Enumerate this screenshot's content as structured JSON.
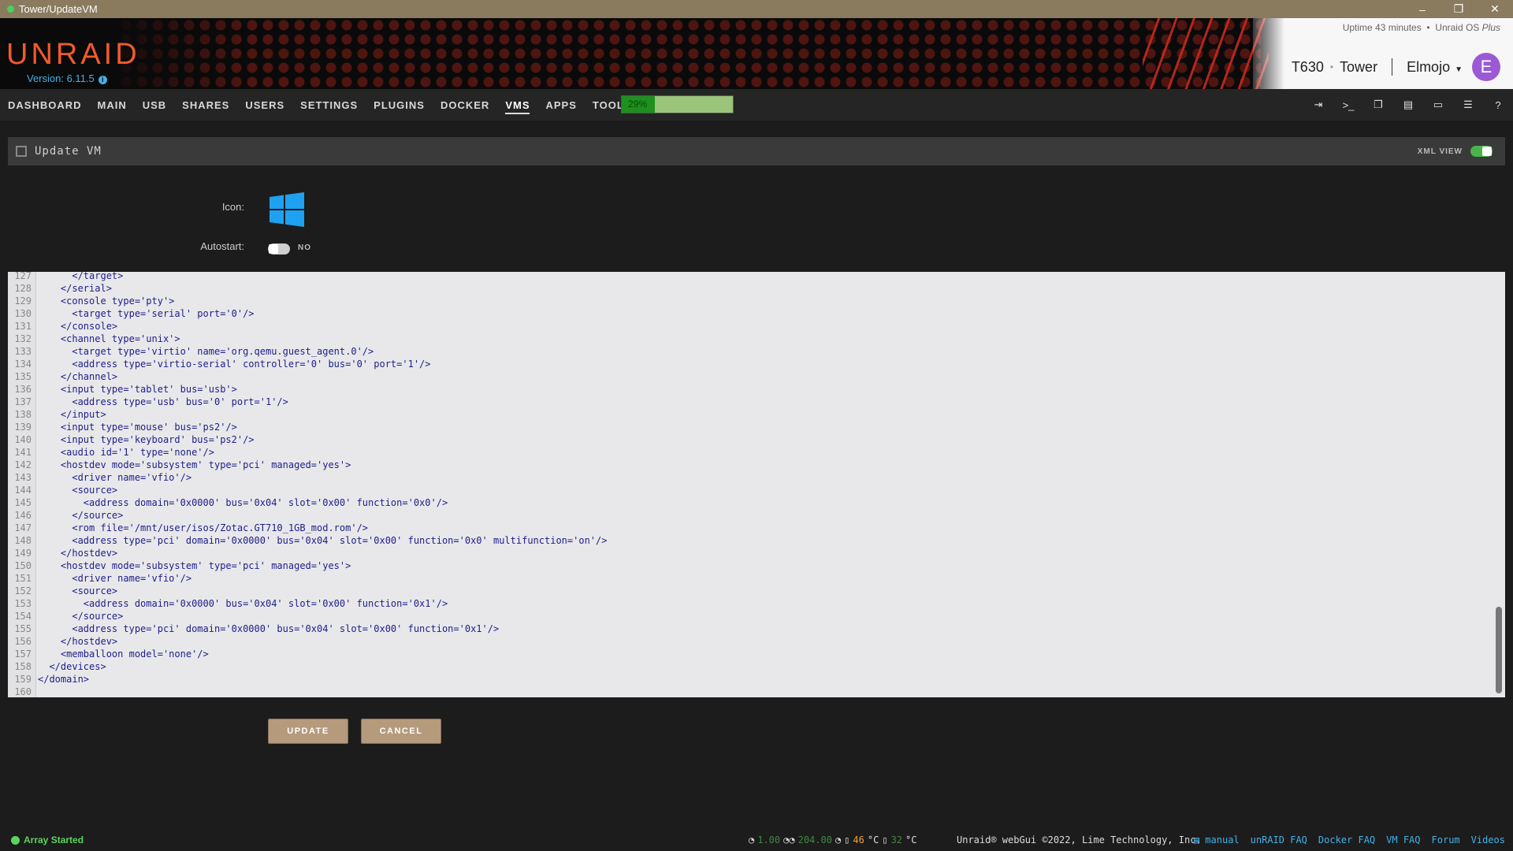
{
  "window": {
    "title": "Tower/UpdateVM",
    "controls": [
      "–",
      "❐",
      "✕"
    ]
  },
  "header": {
    "logo": "UNRAID",
    "version": "Version: 6.11.5",
    "uptime": "Uptime 43 minutes",
    "uptime_sep": "•",
    "os_label": "Unraid OS",
    "os_plus": "Plus",
    "server_model": "T630",
    "server_sep": "•",
    "server_name": "Tower",
    "username": "Elmojo",
    "avatar_letter": "E"
  },
  "nav": {
    "items": [
      "DASHBOARD",
      "MAIN",
      "USB",
      "SHARES",
      "USERS",
      "SETTINGS",
      "PLUGINS",
      "DOCKER",
      "VMS",
      "APPS",
      "TOOLS"
    ],
    "active": "VMS",
    "cpu_label": "29%",
    "cpu_percent": 29,
    "icons": [
      "logout-icon",
      "terminal-icon",
      "windows-icon",
      "feedback-icon",
      "monitor-icon",
      "log-icon",
      "help-icon"
    ]
  },
  "section": {
    "title": "Update VM",
    "xml_view_label": "XML VIEW"
  },
  "form": {
    "icon_label": "Icon:",
    "autostart_label": "Autostart:",
    "autostart_value": "NO"
  },
  "editor": {
    "lines": [
      {
        "n": "127",
        "t": "      </target>"
      },
      {
        "n": "128",
        "t": "    </serial>"
      },
      {
        "n": "129",
        "t": "    <console type='pty'>"
      },
      {
        "n": "130",
        "t": "      <target type='serial' port='0'/>"
      },
      {
        "n": "131",
        "t": "    </console>"
      },
      {
        "n": "132",
        "t": "    <channel type='unix'>"
      },
      {
        "n": "133",
        "t": "      <target type='virtio' name='org.qemu.guest_agent.0'/>"
      },
      {
        "n": "134",
        "t": "      <address type='virtio-serial' controller='0' bus='0' port='1'/>"
      },
      {
        "n": "135",
        "t": "    </channel>"
      },
      {
        "n": "136",
        "t": "    <input type='tablet' bus='usb'>"
      },
      {
        "n": "137",
        "t": "      <address type='usb' bus='0' port='1'/>"
      },
      {
        "n": "138",
        "t": "    </input>"
      },
      {
        "n": "139",
        "t": "    <input type='mouse' bus='ps2'/>"
      },
      {
        "n": "140",
        "t": "    <input type='keyboard' bus='ps2'/>"
      },
      {
        "n": "141",
        "t": "    <audio id='1' type='none'/>"
      },
      {
        "n": "142",
        "t": "    <hostdev mode='subsystem' type='pci' managed='yes'>"
      },
      {
        "n": "143",
        "t": "      <driver name='vfio'/>"
      },
      {
        "n": "144",
        "t": "      <source>"
      },
      {
        "n": "145",
        "t": "        <address domain='0x0000' bus='0x04' slot='0x00' function='0x0'/>"
      },
      {
        "n": "146",
        "t": "      </source>"
      },
      {
        "n": "147",
        "t": "      <rom file='/mnt/user/isos/Zotac.GT710_1GB_mod.rom'/>"
      },
      {
        "n": "148",
        "t": "      <address type='pci' domain='0x0000' bus='0x04' slot='0x00' function='0x0' multifunction='on'/>"
      },
      {
        "n": "149",
        "t": "    </hostdev>"
      },
      {
        "n": "150",
        "t": "    <hostdev mode='subsystem' type='pci' managed='yes'>"
      },
      {
        "n": "151",
        "t": "      <driver name='vfio'/>"
      },
      {
        "n": "152",
        "t": "      <source>"
      },
      {
        "n": "153",
        "t": "        <address domain='0x0000' bus='0x04' slot='0x00' function='0x1'/>"
      },
      {
        "n": "154",
        "t": "      </source>"
      },
      {
        "n": "155",
        "t": "      <address type='pci' domain='0x0000' bus='0x04' slot='0x00' function='0x1'/>"
      },
      {
        "n": "156",
        "t": "    </hostdev>"
      },
      {
        "n": "157",
        "t": "    <memballoon model='none'/>"
      },
      {
        "n": "158",
        "t": "  </devices>"
      },
      {
        "n": "159",
        "t": "</domain>"
      },
      {
        "n": "160",
        "t": ""
      }
    ]
  },
  "buttons": {
    "update": "UPDATE",
    "cancel": "CANCEL"
  },
  "footer": {
    "status": "Array Started",
    "cpu_load": "1.00",
    "net_rate": "204.00",
    "temp_cpu": "46",
    "temp_unit": "°C",
    "temp_mb": "32",
    "copyright": "Unraid® webGui ©2022, Lime Technology, Inc.",
    "links": [
      "manual",
      "unRAID FAQ",
      "Docker FAQ",
      "VM FAQ",
      "Forum",
      "Videos"
    ]
  },
  "colors": {
    "accent_orange": "#f15a2c",
    "link_blue": "#44b0e6",
    "ok_green": "#5dd35d",
    "button": "#b59a7c"
  }
}
